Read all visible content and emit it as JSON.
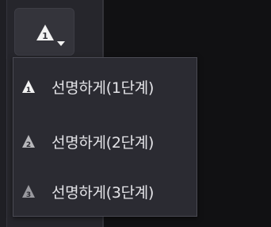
{
  "toolbar": {
    "sharpen_button": {
      "icon": "sharpen-triangle-icon",
      "dropdown_icon": "caret-down-icon"
    }
  },
  "menu": {
    "items": [
      {
        "label": "선명하게(1단계)",
        "icon": "sharpen-level-1-icon",
        "badge": "1"
      },
      {
        "label": "선명하게(2단계)",
        "icon": "sharpen-level-2-icon",
        "badge": "2"
      },
      {
        "label": "선명하게(3단계)",
        "icon": "sharpen-level-3-icon",
        "badge": "3"
      }
    ]
  },
  "colors": {
    "panel": "#26262c",
    "menu_bg": "#2b2b32",
    "menu_border": "#4a4a53",
    "text": "#e4e4e8",
    "icon_white": "#f2f2f2",
    "icon_gray": "#9a9aa0"
  }
}
